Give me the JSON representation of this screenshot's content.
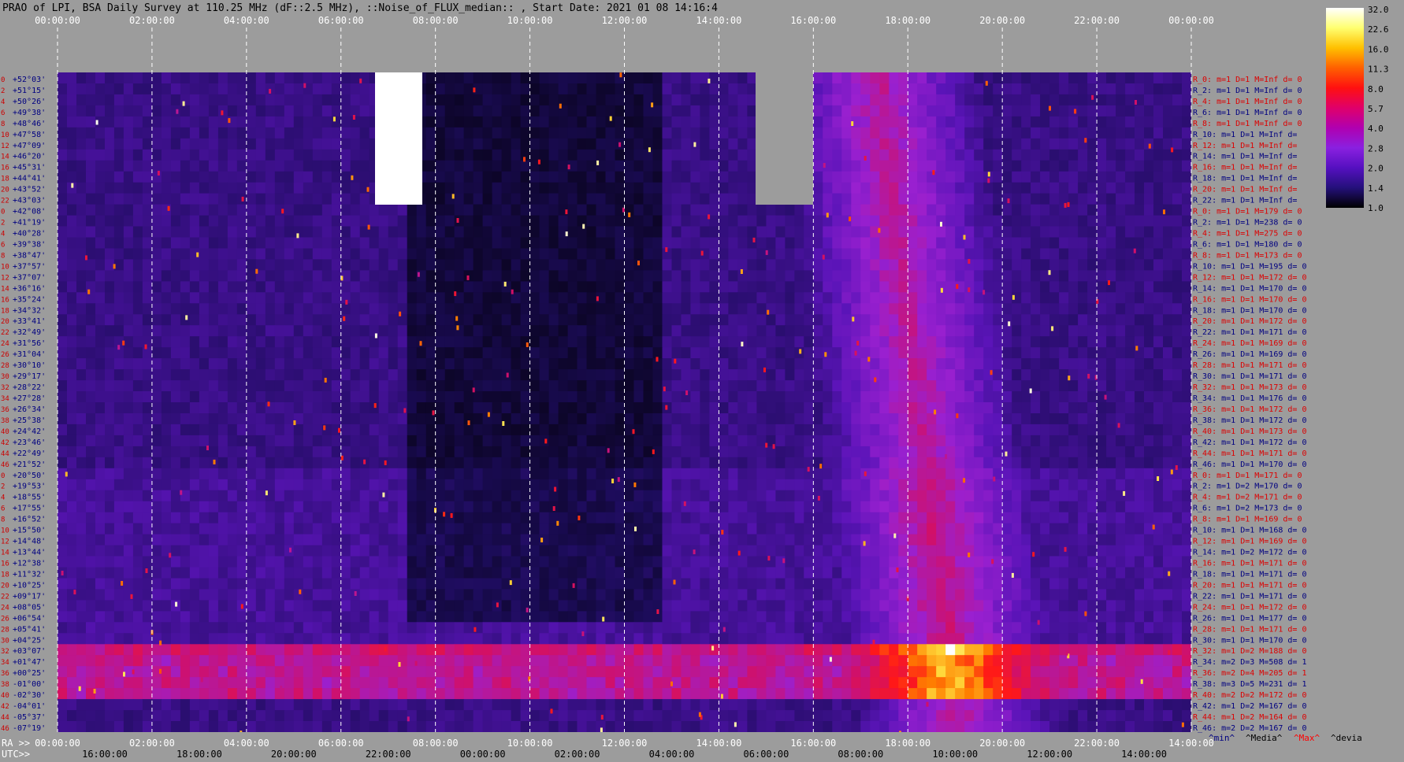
{
  "title": "PRAO of LPI, BSA Daily Survey at 110.25 MHz (dF::2.5 MHz), ::Noise_of_FLUX_median:: , Start Date: 2021 01 08 14:16:4",
  "colorbar": {
    "labels": [
      "32.0",
      "22.6",
      "16.0",
      "11.3",
      "8.0",
      "5.7",
      "4.0",
      "2.8",
      "2.0",
      "1.4",
      "1.0"
    ],
    "stops": [
      "#ffffff",
      "#ffff70",
      "#ffc000",
      "#ff6000",
      "#ff1010",
      "#e0006a",
      "#b000b0",
      "#8a20e0",
      "#5510c0",
      "#24107a",
      "#000000"
    ]
  },
  "chart_data": {
    "type": "heatmap",
    "title": "PRAO of LPI, BSA Daily Survey at 110.25 MHz (dF::2.5 MHz), ::Noise_of_FLUX_median:: , Start Date: 2021 01 08 14:16:4",
    "top_time_ticks": [
      "00:00:00",
      "02:00:00",
      "04:00:00",
      "06:00:00",
      "08:00:00",
      "10:00:00",
      "12:00:00",
      "14:00:00",
      "16:00:00",
      "18:00:00",
      "20:00:00",
      "22:00:00",
      "00:00:00"
    ],
    "ra_ticks": [
      "00:00:00",
      "02:00:00",
      "04:00:00",
      "06:00:00",
      "08:00:00",
      "10:00:00",
      "12:00:00",
      "14:00:00",
      "16:00:00",
      "18:00:00",
      "20:00:00",
      "22:00:00",
      "14:00:00"
    ],
    "utc_ticks": [
      "16:00:00",
      "18:00:00",
      "20:00:00",
      "22:00:00",
      "00:00:00",
      "02:00:00",
      "04:00:00",
      "06:00:00",
      "08:00:00",
      "10:00:00",
      "12:00:00",
      "14:00:00"
    ],
    "ra_label": "RA >>",
    "utc_label": "UTC>>",
    "beam_numbers": [
      "0",
      "2",
      "4",
      "6",
      "8",
      "10",
      "12",
      "14",
      "16",
      "18",
      "20",
      "22",
      "0",
      "2",
      "4",
      "6",
      "8",
      "10",
      "12",
      "14",
      "16",
      "18",
      "20",
      "22",
      "24",
      "26",
      "28",
      "30",
      "32",
      "34",
      "36",
      "38",
      "40",
      "42",
      "44",
      "46",
      "0",
      "2",
      "4",
      "6",
      "8",
      "10",
      "12",
      "14",
      "16",
      "18",
      "20",
      "22",
      "24",
      "26",
      "28",
      "30",
      "32",
      "34",
      "36",
      "38",
      "40",
      "42",
      "44",
      "46"
    ],
    "declinations": [
      "+52°03'",
      "+51°15'",
      "+50°26'",
      "+49°38'",
      "+48°46'",
      "+47°58'",
      "+47°09'",
      "+46°20'",
      "+45°31'",
      "+44°41'",
      "+43°52'",
      "+43°03'",
      "+42°08'",
      "+41°19'",
      "+40°28'",
      "+39°38'",
      "+38°47'",
      "+37°57'",
      "+37°07'",
      "+36°16'",
      "+35°24'",
      "+34°32'",
      "+33°41'",
      "+32°49'",
      "+31°56'",
      "+31°04'",
      "+30°10'",
      "+29°17'",
      "+28°22'",
      "+27°28'",
      "+26°34'",
      "+25°38'",
      "+24°42'",
      "+23°46'",
      "+22°49'",
      "+21°52'",
      "+20°50'",
      "+19°53'",
      "+18°55'",
      "+17°55'",
      "+16°52'",
      "+15°50'",
      "+14°48'",
      "+13°44'",
      "+12°38'",
      "+11°32'",
      "+10°25'",
      "+09°17'",
      "+08°05'",
      "+06°54'",
      "+05°41'",
      "+04°25'",
      "+03°07'",
      "+01°47'",
      "+00°25'",
      "-01°00'",
      "-02°30'",
      "-04°01'",
      "-05°37'",
      "-07°19'"
    ],
    "right_labels": [
      "R_0: m=1 D=1 M=Inf d= 0",
      "R_2: m=1 D=1 M=Inf d= 0",
      "R_4: m=1 D=1 M=Inf d= 0",
      "R_6: m=1 D=1 M=Inf d= 0",
      "R_8: m=1 D=1 M=Inf d= 0",
      "R_10: m=1 D=1 M=Inf d=",
      "R_12: m=1 D=1 M=Inf d=",
      "R_14: m=1 D=1 M=Inf d=",
      "R_16: m=1 D=1 M=Inf d=",
      "R_18: m=1 D=1 M=Inf d=",
      "R_20: m=1 D=1 M=Inf d=",
      "R_22: m=1 D=1 M=Inf d=",
      "R_0: m=1 D=1 M=179 d= 0",
      "R_2: m=1 D=1 M=238 d= 0",
      "R_4: m=1 D=1 M=275 d= 0",
      "R_6: m=1 D=1 M=180 d= 0",
      "R_8: m=1 D=1 M=173 d= 0",
      "R_10: m=1 D=1 M=195 d= 0",
      "R_12: m=1 D=1 M=172 d= 0",
      "R_14: m=1 D=1 M=170 d= 0",
      "R_16: m=1 D=1 M=170 d= 0",
      "R_18: m=1 D=1 M=170 d= 0",
      "R_20: m=1 D=1 M=172 d= 0",
      "R_22: m=1 D=1 M=171 d= 0",
      "R_24: m=1 D=1 M=169 d= 0",
      "R_26: m=1 D=1 M=169 d= 0",
      "R_28: m=1 D=1 M=171 d= 0",
      "R_30: m=1 D=1 M=171 d= 0",
      "R_32: m=1 D=1 M=173 d= 0",
      "R_34: m=1 D=1 M=176 d= 0",
      "R_36: m=1 D=1 M=172 d= 0",
      "R_38: m=1 D=1 M=172 d= 0",
      "R_40: m=1 D=1 M=173 d= 0",
      "R_42: m=1 D=1 M=172 d= 0",
      "R_44: m=1 D=1 M=171 d= 0",
      "R_46: m=1 D=1 M=170 d= 0",
      "R_0: m=1 D=1 M=171 d= 0",
      "R_2: m=1 D=2 M=170 d= 0",
      "R_4: m=1 D=2 M=171 d= 0",
      "R_6: m=1 D=2 M=173 d= 0",
      "R_8: m=1 D=1 M=169 d= 0",
      "R_10: m=1 D=1 M=168 d= 0",
      "R_12: m=1 D=1 M=169 d= 0",
      "R_14: m=1 D=2 M=172 d= 0",
      "R_16: m=1 D=1 M=171 d= 0",
      "R_18: m=1 D=1 M=171 d= 0",
      "R_20: m=1 D=1 M=171 d= 0",
      "R_22: m=1 D=1 M=171 d= 0",
      "R_24: m=1 D=1 M=172 d= 0",
      "R_26: m=1 D=1 M=177 d= 0",
      "R_28: m=1 D=1 M=171 d= 0",
      "R_30: m=1 D=1 M=170 d= 0",
      "R_32: m=1 D=2 M=188 d= 0",
      "R_34: m=2 D=3 M=508 d= 1",
      "R_36: m=2 D=4 M=205 d= 1",
      "R_38: m=3 D=5 M=231 d= 1",
      "R_40: m=2 D=2 M=172 d= 0",
      "R_42: m=1 D=2 M=167 d= 0",
      "R_44: m=1 D=2 M=164 d= 0",
      "R_46: m=2 D=2 M=167 d= 0"
    ],
    "footer_legend": [
      {
        "text": "^min^",
        "color": "#000080"
      },
      {
        "text": "^Media^",
        "color": "#000000"
      },
      {
        "text": "^Max^",
        "color": "#ff0000"
      },
      {
        "text": "^devia",
        "color": "#000000"
      }
    ],
    "grid": true
  }
}
